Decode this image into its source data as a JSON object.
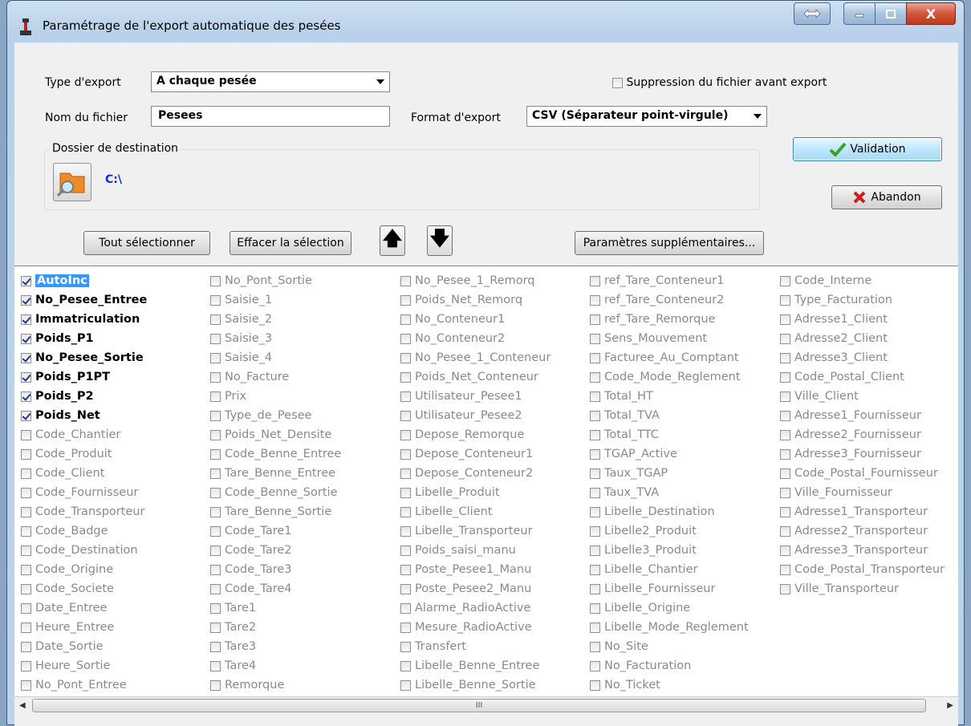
{
  "window": {
    "title": "Paramétrage de l'export automatique des pesées",
    "close_glyph": "X"
  },
  "form": {
    "type_export_label": "Type d'export",
    "type_export_value": "A chaque pesée",
    "suppression_label": "Suppression du fichier avant export",
    "suppression_checked": false,
    "nom_fichier_label": "Nom du fichier",
    "nom_fichier_value": "Pesees",
    "format_export_label": "Format d'export",
    "format_export_value": "CSV (Séparateur point-virgule)",
    "dossier_label": "Dossier de destination",
    "dossier_path": "C:\\"
  },
  "buttons": {
    "validation": "Validation",
    "abandon": "Abandon",
    "tout_selectionner": "Tout sélectionner",
    "effacer_selection": "Effacer la sélection",
    "parametres_supp": "Paramètres supplémentaires...",
    "up_glyph": "🡅",
    "down_glyph": "🡇"
  },
  "scrollbar": {
    "thumb_grip": "III"
  },
  "fields": [
    [
      {
        "label": "AutoInc",
        "checked": true,
        "selected": true
      },
      {
        "label": "No_Pesee_Entree",
        "checked": true
      },
      {
        "label": "Immatriculation",
        "checked": true
      },
      {
        "label": "Poids_P1",
        "checked": true
      },
      {
        "label": "No_Pesee_Sortie",
        "checked": true
      },
      {
        "label": "Poids_P1PT",
        "checked": true
      },
      {
        "label": "Poids_P2",
        "checked": true
      },
      {
        "label": "Poids_Net",
        "checked": true
      },
      {
        "label": "Code_Chantier",
        "checked": false
      },
      {
        "label": "Code_Produit",
        "checked": false
      },
      {
        "label": "Code_Client",
        "checked": false
      },
      {
        "label": "Code_Fournisseur",
        "checked": false
      },
      {
        "label": "Code_Transporteur",
        "checked": false
      },
      {
        "label": "Code_Badge",
        "checked": false
      },
      {
        "label": "Code_Destination",
        "checked": false
      },
      {
        "label": "Code_Origine",
        "checked": false
      },
      {
        "label": "Code_Societe",
        "checked": false
      },
      {
        "label": "Date_Entree",
        "checked": false
      },
      {
        "label": "Heure_Entree",
        "checked": false
      },
      {
        "label": "Date_Sortie",
        "checked": false
      },
      {
        "label": "Heure_Sortie",
        "checked": false
      },
      {
        "label": "No_Pont_Entree",
        "checked": false
      }
    ],
    [
      {
        "label": "No_Pont_Sortie",
        "checked": false
      },
      {
        "label": "Saisie_1",
        "checked": false
      },
      {
        "label": "Saisie_2",
        "checked": false
      },
      {
        "label": "Saisie_3",
        "checked": false
      },
      {
        "label": "Saisie_4",
        "checked": false
      },
      {
        "label": "No_Facture",
        "checked": false
      },
      {
        "label": "Prix",
        "checked": false
      },
      {
        "label": "Type_de_Pesee",
        "checked": false
      },
      {
        "label": "Poids_Net_Densite",
        "checked": false
      },
      {
        "label": "Code_Benne_Entree",
        "checked": false
      },
      {
        "label": "Tare_Benne_Entree",
        "checked": false
      },
      {
        "label": "Code_Benne_Sortie",
        "checked": false
      },
      {
        "label": "Tare_Benne_Sortie",
        "checked": false
      },
      {
        "label": "Code_Tare1",
        "checked": false
      },
      {
        "label": "Code_Tare2",
        "checked": false
      },
      {
        "label": "Code_Tare3",
        "checked": false
      },
      {
        "label": "Code_Tare4",
        "checked": false
      },
      {
        "label": "Tare1",
        "checked": false
      },
      {
        "label": "Tare2",
        "checked": false
      },
      {
        "label": "Tare3",
        "checked": false
      },
      {
        "label": "Tare4",
        "checked": false
      },
      {
        "label": "Remorque",
        "checked": false
      }
    ],
    [
      {
        "label": "No_Pesee_1_Remorq",
        "checked": false
      },
      {
        "label": "Poids_Net_Remorq",
        "checked": false
      },
      {
        "label": "No_Conteneur1",
        "checked": false
      },
      {
        "label": "No_Conteneur2",
        "checked": false
      },
      {
        "label": "No_Pesee_1_Conteneur",
        "checked": false
      },
      {
        "label": "Poids_Net_Conteneur",
        "checked": false
      },
      {
        "label": "Utilisateur_Pesee1",
        "checked": false
      },
      {
        "label": "Utilisateur_Pesee2",
        "checked": false
      },
      {
        "label": "Depose_Remorque",
        "checked": false
      },
      {
        "label": "Depose_Conteneur1",
        "checked": false
      },
      {
        "label": "Depose_Conteneur2",
        "checked": false
      },
      {
        "label": "Libelle_Produit",
        "checked": false
      },
      {
        "label": "Libelle_Client",
        "checked": false
      },
      {
        "label": "Libelle_Transporteur",
        "checked": false
      },
      {
        "label": "Poids_saisi_manu",
        "checked": false
      },
      {
        "label": "Poste_Pesee1_Manu",
        "checked": false
      },
      {
        "label": "Poste_Pesee2_Manu",
        "checked": false
      },
      {
        "label": "Alarme_RadioActive",
        "checked": false
      },
      {
        "label": "Mesure_RadioActive",
        "checked": false
      },
      {
        "label": "Transfert",
        "checked": false
      },
      {
        "label": "Libelle_Benne_Entree",
        "checked": false
      },
      {
        "label": "Libelle_Benne_Sortie",
        "checked": false
      }
    ],
    [
      {
        "label": "ref_Tare_Conteneur1",
        "checked": false
      },
      {
        "label": "ref_Tare_Conteneur2",
        "checked": false
      },
      {
        "label": "ref_Tare_Remorque",
        "checked": false
      },
      {
        "label": "Sens_Mouvement",
        "checked": false
      },
      {
        "label": "Facturee_Au_Comptant",
        "checked": false
      },
      {
        "label": "Code_Mode_Reglement",
        "checked": false
      },
      {
        "label": "Total_HT",
        "checked": false
      },
      {
        "label": "Total_TVA",
        "checked": false
      },
      {
        "label": "Total_TTC",
        "checked": false
      },
      {
        "label": "TGAP_Active",
        "checked": false
      },
      {
        "label": "Taux_TGAP",
        "checked": false
      },
      {
        "label": "Taux_TVA",
        "checked": false
      },
      {
        "label": "Libelle_Destination",
        "checked": false
      },
      {
        "label": "Libelle2_Produit",
        "checked": false
      },
      {
        "label": "Libelle3_Produit",
        "checked": false
      },
      {
        "label": "Libelle_Chantier",
        "checked": false
      },
      {
        "label": "Libelle_Fournisseur",
        "checked": false
      },
      {
        "label": "Libelle_Origine",
        "checked": false
      },
      {
        "label": "Libelle_Mode_Reglement",
        "checked": false
      },
      {
        "label": "No_Site",
        "checked": false
      },
      {
        "label": "No_Facturation",
        "checked": false
      },
      {
        "label": "No_Ticket",
        "checked": false
      }
    ],
    [
      {
        "label": "Code_Interne",
        "checked": false
      },
      {
        "label": "Type_Facturation",
        "checked": false
      },
      {
        "label": "Adresse1_Client",
        "checked": false
      },
      {
        "label": "Adresse2_Client",
        "checked": false
      },
      {
        "label": "Adresse3_Client",
        "checked": false
      },
      {
        "label": "Code_Postal_Client",
        "checked": false
      },
      {
        "label": "Ville_Client",
        "checked": false
      },
      {
        "label": "Adresse1_Fournisseur",
        "checked": false
      },
      {
        "label": "Adresse2_Fournisseur",
        "checked": false
      },
      {
        "label": "Adresse3_Fournisseur",
        "checked": false
      },
      {
        "label": "Code_Postal_Fournisseur",
        "checked": false
      },
      {
        "label": "Ville_Fournisseur",
        "checked": false
      },
      {
        "label": "Adresse1_Transporteur",
        "checked": false
      },
      {
        "label": "Adresse2_Transporteur",
        "checked": false
      },
      {
        "label": "Adresse3_Transporteur",
        "checked": false
      },
      {
        "label": "Code_Postal_Transporteur",
        "checked": false
      },
      {
        "label": "Ville_Transporteur",
        "checked": false
      }
    ]
  ]
}
